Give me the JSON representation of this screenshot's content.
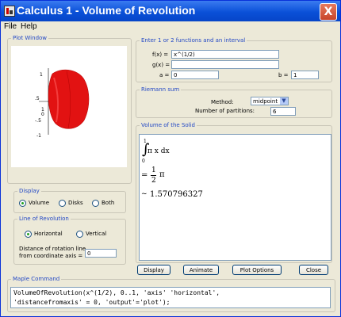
{
  "window": {
    "title": "Calculus 1 - Volume of Revolution",
    "close_glyph": "X"
  },
  "menu": [
    "File",
    "Help"
  ],
  "plot_window": {
    "legend": "Plot Window",
    "axis_labels": [
      "1",
      ".5",
      "1",
      "0",
      "-.5",
      "-1"
    ],
    "surface_color": "#ff0000"
  },
  "display": {
    "legend": "Display",
    "options": [
      "Volume",
      "Disks",
      "Both"
    ],
    "selected": "Volume"
  },
  "line_of_revolution": {
    "legend": "Line of Revolution",
    "options": [
      "Horizontal",
      "Vertical"
    ],
    "selected": "Horizontal",
    "distance_label_1": "Distance of rotation line",
    "distance_label_2": "from coordinate axis =",
    "distance_value": "0"
  },
  "functions": {
    "legend": "Enter 1 or 2 functions and an interval",
    "f_label": "f(x) =",
    "f_value": "x^(1/2)",
    "g_label": "g(x) =",
    "g_value": "",
    "a_label": "a =",
    "a_value": "0",
    "b_label": "b =",
    "b_value": "1"
  },
  "riemann": {
    "legend": "Riemann sum",
    "method_label": "Method:",
    "method_value": "midpoint",
    "partitions_label": "Number of partitions:",
    "partitions_value": "6"
  },
  "volume": {
    "legend": "Volume of the Solid",
    "upper": "1",
    "integrand": "π x dx",
    "lower": "0",
    "eq1_num": "1",
    "eq1_den": "2",
    "eq1_var": "π",
    "eq2": "1.570796327"
  },
  "buttons": {
    "display": "Display",
    "animate": "Animate",
    "plot_options": "Plot Options",
    "close": "Close"
  },
  "command": {
    "legend": "Maple Command",
    "line1": "VolumeOfRevolution(x^(1/2), 0..1, 'axis' 'horizontal',",
    "line2": "'distancefromaxis' = 0, 'output'='plot');"
  }
}
